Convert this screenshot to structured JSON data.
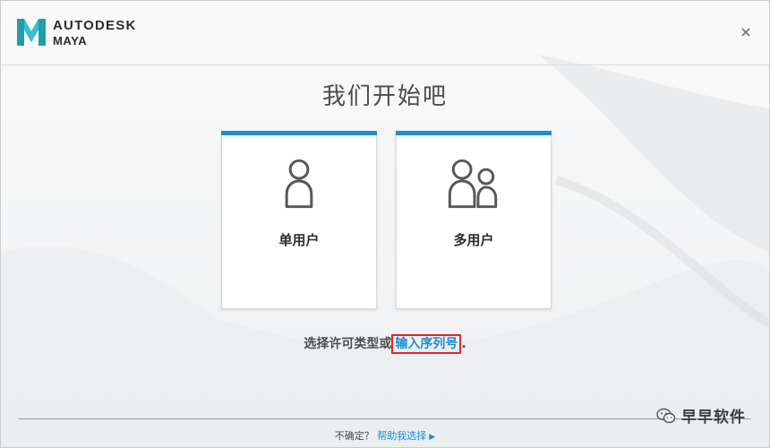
{
  "header": {
    "brand": "AUTODESK",
    "product": "MAYA",
    "close_glyph": "×"
  },
  "main": {
    "title": "我们开始吧",
    "cards": [
      {
        "label": "单用户",
        "icon": "single-user-icon"
      },
      {
        "label": "多用户",
        "icon": "multi-user-icon"
      }
    ],
    "license_prompt": "选择许可类型或",
    "serial_link": "输入序列号",
    "serial_suffix": "."
  },
  "footer": {
    "unsure": "不确定？",
    "help_link": "帮助我选择",
    "arrow": "▶"
  },
  "watermark": {
    "text": "早早软件",
    "icon": "wechat-icon"
  },
  "colors": {
    "accent": "#1a8fd6",
    "highlight_box": "#e2262d",
    "text": "#4a4c4e"
  }
}
